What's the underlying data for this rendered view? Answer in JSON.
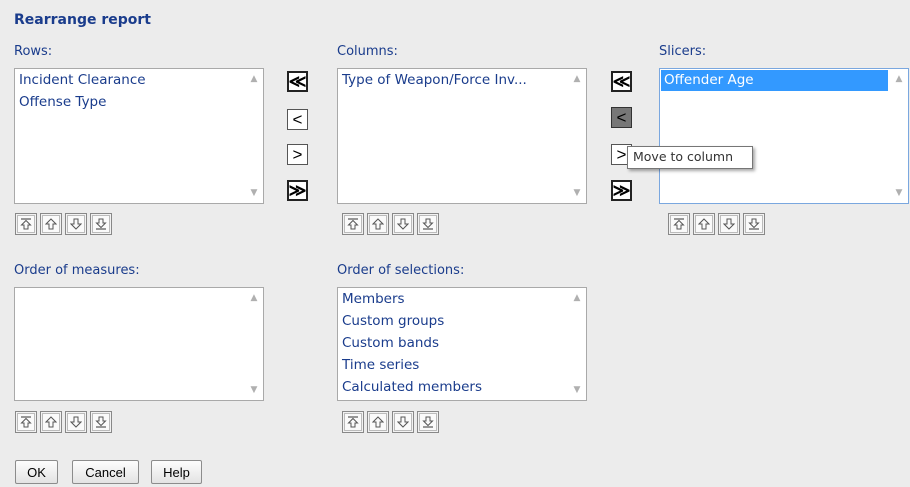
{
  "dialog": {
    "title": "Rearrange report"
  },
  "rows": {
    "label": "Rows:",
    "items": [
      "Incident Clearance",
      "Offense Type"
    ]
  },
  "columns": {
    "label": "Columns:",
    "items": [
      "Type of Weapon/Force Inv..."
    ]
  },
  "slicers": {
    "label": "Slicers:",
    "items": [
      "Offender Age"
    ],
    "selected": "Offender Age"
  },
  "order_measures": {
    "label": "Order of measures:",
    "items": []
  },
  "order_selections": {
    "label": "Order of selections:",
    "items": [
      "Members",
      "Custom groups",
      "Custom bands",
      "Time series",
      "Calculated members"
    ]
  },
  "move_buttons": {
    "all_left": "≪",
    "left": "<",
    "right": ">",
    "all_right": "≫"
  },
  "tooltip": {
    "text": "Move to column"
  },
  "footer": {
    "ok": "OK",
    "cancel": "Cancel",
    "help": "Help"
  }
}
